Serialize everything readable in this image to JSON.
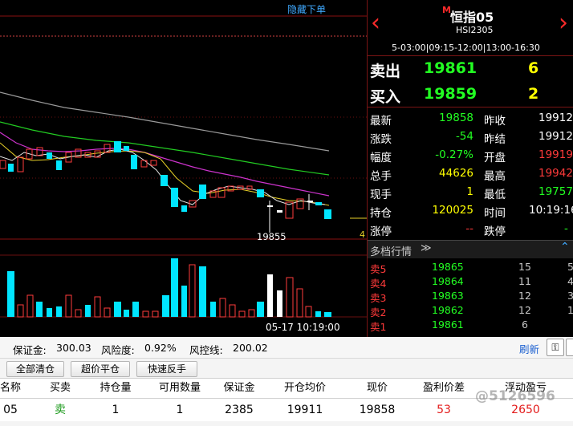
{
  "chart": {
    "hide_order_link": "隐藏下单",
    "low_label": "19855",
    "time_label": "05-17 10:19:00",
    "edge_label": "4",
    "candles": [
      {
        "o": 1,
        "c": 0,
        "h": 1,
        "l": 0
      },
      {
        "o": 0,
        "c": 0,
        "h": 0,
        "l": 0
      }
    ]
  },
  "instrument": {
    "badge": "M",
    "name": "恒指05",
    "code": "HSI2305",
    "session": "5-03:00|09:15-12:00|13:00-16:30"
  },
  "orderbook_top": {
    "sell_label": "卖出",
    "sell_price": "19861",
    "sell_qty": "6",
    "buy_label": "买入",
    "buy_price": "19859",
    "buy_qty": "2"
  },
  "quote": {
    "latest_label": "最新",
    "latest": "19858",
    "prev_close_label": "昨收",
    "prev_close": "19912",
    "change_label": "涨跌",
    "change": "-54",
    "prev_settle_label": "昨结",
    "prev_settle": "19912",
    "pct_label": "幅度",
    "pct": "-0.27%",
    "open_label": "开盘",
    "open": "19919",
    "total_label": "总手",
    "total": "44626",
    "high_label": "最高",
    "high": "19942",
    "current_label": "现手",
    "current": "1",
    "low_label": "最低",
    "low": "19757",
    "oi_label": "持仓",
    "oi": "120025",
    "time_label": "时间",
    "time": "10:19:16",
    "limit_up_label": "涨停",
    "limit_up": "--",
    "limit_down_label": "跌停",
    "limit_down": "-"
  },
  "depth": {
    "title": "多档行情",
    "rows": [
      {
        "label": "卖5",
        "price": "19865",
        "qty": "15",
        "extra": "5"
      },
      {
        "label": "卖4",
        "price": "19864",
        "qty": "11",
        "extra": "4"
      },
      {
        "label": "卖3",
        "price": "19863",
        "qty": "12",
        "extra": "3"
      },
      {
        "label": "卖2",
        "price": "19862",
        "qty": "12",
        "extra": "1"
      },
      {
        "label": "卖1",
        "price": "19861",
        "qty": "6",
        "extra": ""
      }
    ]
  },
  "account": {
    "margin_label": "保证金:",
    "margin": "300.03",
    "risk_label": "风险度:",
    "risk": "0.92%",
    "stop_label": "风控线:",
    "stop": "200.02",
    "refresh": "刷新"
  },
  "actions": {
    "close_all": "全部清仓",
    "over_price_close": "超价平仓",
    "quick_reverse": "快速反手"
  },
  "positions": {
    "headers": [
      "名称",
      "买卖",
      "持仓量",
      "可用数量",
      "保证金",
      "开仓均价",
      "现价",
      "盈利价差",
      "浮动盈亏"
    ],
    "rows": [
      [
        "05",
        "卖",
        "1",
        "1",
        "2385",
        "19911",
        "19858",
        "53",
        "2650"
      ]
    ]
  },
  "watermark": "@5126596"
}
